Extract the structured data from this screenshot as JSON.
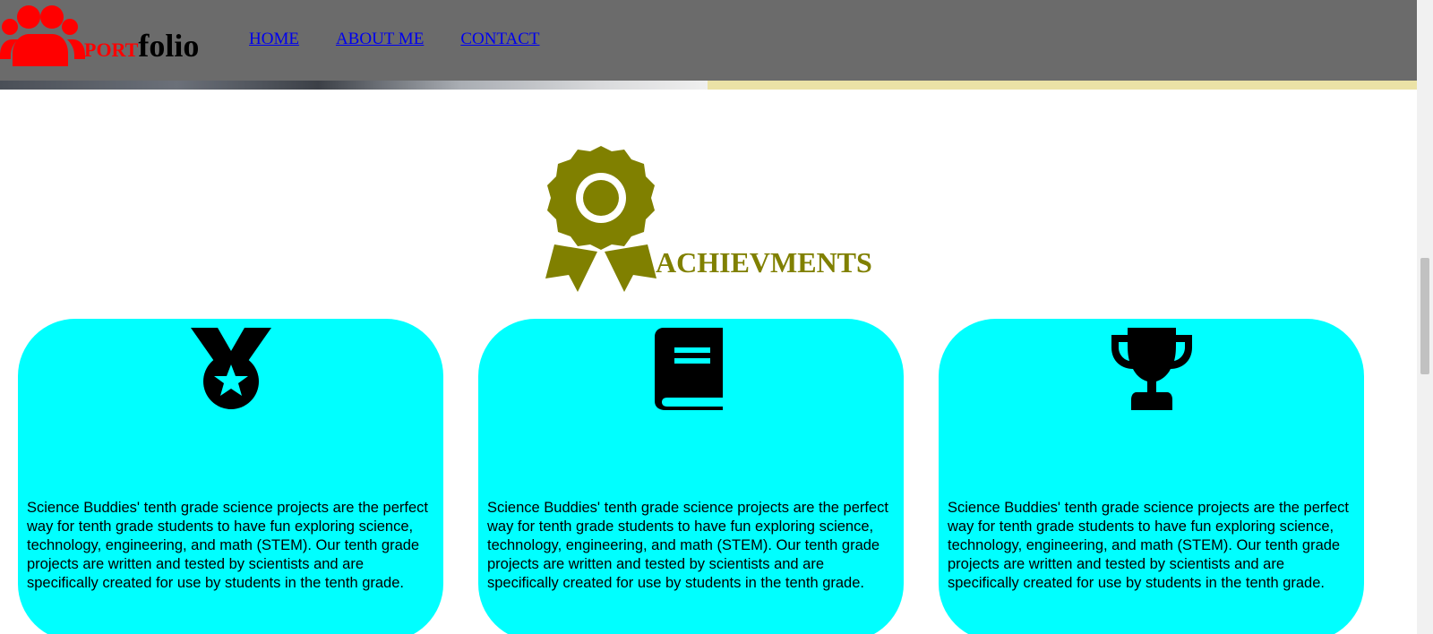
{
  "header": {
    "brand_prefix": "PORT",
    "brand_suffix": "folio",
    "logo_icon": "users-icon",
    "nav": [
      {
        "label": "HOME"
      },
      {
        "label": "ABOUT ME"
      },
      {
        "label": "CONTACT"
      }
    ]
  },
  "section": {
    "title": "ACHIEVMENTS",
    "icon": "award-ribbon-icon",
    "title_color": "#808000"
  },
  "cards": [
    {
      "icon": "medal-icon",
      "text": "Science Buddies' tenth grade science projects are the perfect way for tenth grade students to have fun exploring science, technology, engineering, and math (STEM). Our tenth grade projects are written and tested by scientists and are specifically created for use by students in the tenth grade."
    },
    {
      "icon": "book-icon",
      "text": "Science Buddies' tenth grade science projects are the perfect way for tenth grade students to have fun exploring science, technology, engineering, and math (STEM). Our tenth grade projects are written and tested by scientists and are specifically created for use by students in the tenth grade."
    },
    {
      "icon": "trophy-icon",
      "text": "Science Buddies' tenth grade science projects are the perfect way for tenth grade students to have fun exploring science, technology, engineering, and math (STEM). Our tenth grade projects are written and tested by scientists and are specifically created for use by students in the tenth grade."
    }
  ],
  "colors": {
    "header_bg": "#6b6b6b",
    "card_bg": "#00ffff",
    "brand_accent": "#ff0000",
    "link": "#0000ee"
  }
}
